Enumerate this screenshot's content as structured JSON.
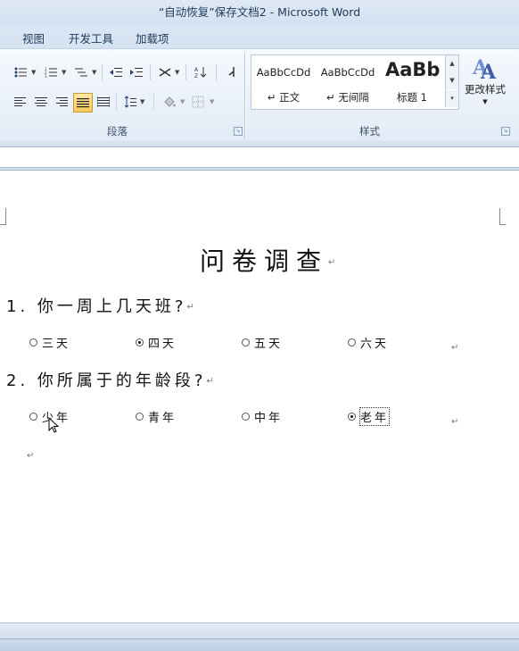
{
  "window": {
    "title": "“自动恢复”保存文档2  -  Microsoft Word"
  },
  "tabs": [
    "视图",
    "开发工具",
    "加载项"
  ],
  "ribbon": {
    "paragraph_group_label": "段落",
    "styles_group_label": "样式",
    "styles": [
      {
        "preview": "AaBbCcDd",
        "name": "↵ 正文"
      },
      {
        "preview": "AaBbCcDd",
        "name": "↵ 无间隔"
      },
      {
        "preview": "AaBb",
        "name": "标题 1"
      }
    ],
    "change_styles_label": "更改样式",
    "active_alignment": "justify"
  },
  "document": {
    "title": "问卷调查",
    "paragraph_mark": "↵",
    "questions": [
      {
        "text": "1. 你一周上几天班?",
        "options": [
          {
            "label": "三天",
            "checked": false
          },
          {
            "label": "四天",
            "checked": true
          },
          {
            "label": "五天",
            "checked": false
          },
          {
            "label": "六天",
            "checked": false
          }
        ]
      },
      {
        "text": "2. 你所属于的年龄段?",
        "options": [
          {
            "label": "少年",
            "checked": false
          },
          {
            "label": "青年",
            "checked": false
          },
          {
            "label": "中年",
            "checked": false
          },
          {
            "label": "老年",
            "checked": true
          }
        ]
      }
    ]
  }
}
